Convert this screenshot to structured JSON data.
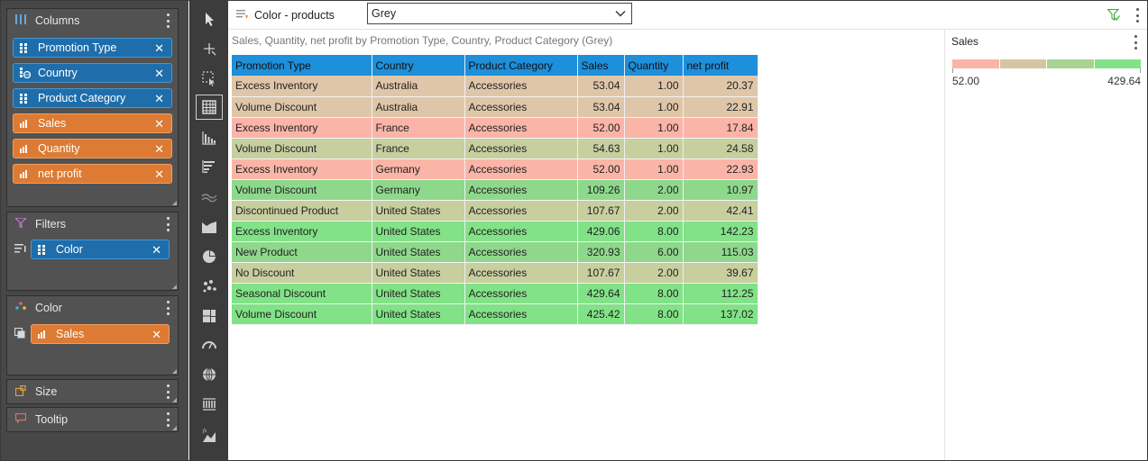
{
  "panels": {
    "columns": {
      "label": "Columns",
      "items": [
        {
          "label": "Promotion Type",
          "kind": "dimension"
        },
        {
          "label": "Country",
          "kind": "geo-dimension"
        },
        {
          "label": "Product Category",
          "kind": "dimension"
        },
        {
          "label": "Sales",
          "kind": "measure"
        },
        {
          "label": "Quantity",
          "kind": "measure"
        },
        {
          "label": "net profit",
          "kind": "measure"
        }
      ]
    },
    "filters": {
      "label": "Filters",
      "items": [
        {
          "label": "Color",
          "kind": "dimension"
        }
      ]
    },
    "color": {
      "label": "Color",
      "items": [
        {
          "label": "Sales",
          "kind": "measure"
        }
      ]
    },
    "size": {
      "label": "Size"
    },
    "tooltip": {
      "label": "Tooltip"
    }
  },
  "toolbar": {
    "tools": [
      "pointer-icon",
      "crosshair-icon",
      "marquee-select-icon",
      "table-icon",
      "column-chart-icon",
      "bar-chart-icon",
      "line-chart-icon",
      "area-chart-icon",
      "pie-chart-icon",
      "scatter-icon",
      "treemap-icon",
      "gauge-icon",
      "map-globe-icon",
      "pivot-grid-icon",
      "formula-chart-icon"
    ],
    "active": "table-icon"
  },
  "header": {
    "title": "Color - products",
    "select_value": "Grey"
  },
  "subtitle": "Sales, Quantity, net profit by Promotion Type, Country, Product Category (Grey)",
  "table": {
    "columns": [
      "Promotion Type",
      "Country",
      "Product Category",
      "Sales",
      "Quantity",
      "net profit"
    ],
    "rows": [
      {
        "cells": [
          "Excess Inventory",
          "Australia",
          "Accessories",
          "53.04",
          "1.00",
          "20.37"
        ],
        "color": "#dfc6a9"
      },
      {
        "cells": [
          "Volume Discount",
          "Australia",
          "Accessories",
          "53.04",
          "1.00",
          "22.91"
        ],
        "color": "#dfc6a9"
      },
      {
        "cells": [
          "Excess Inventory",
          "France",
          "Accessories",
          "52.00",
          "1.00",
          "17.84"
        ],
        "color": "#fab5a8"
      },
      {
        "cells": [
          "Volume Discount",
          "France",
          "Accessories",
          "54.63",
          "1.00",
          "24.58"
        ],
        "color": "#c7cf9f"
      },
      {
        "cells": [
          "Excess Inventory",
          "Germany",
          "Accessories",
          "52.00",
          "1.00",
          "22.93"
        ],
        "color": "#fab5a8"
      },
      {
        "cells": [
          "Volume Discount",
          "Germany",
          "Accessories",
          "109.26",
          "2.00",
          "10.97"
        ],
        "color": "#8ed88c"
      },
      {
        "cells": [
          "Discontinued Product",
          "United States",
          "Accessories",
          "107.67",
          "2.00",
          "42.41"
        ],
        "color": "#c7cf9f"
      },
      {
        "cells": [
          "Excess Inventory",
          "United States",
          "Accessories",
          "429.06",
          "8.00",
          "142.23"
        ],
        "color": "#82e287"
      },
      {
        "cells": [
          "New Product",
          "United States",
          "Accessories",
          "320.93",
          "6.00",
          "115.03"
        ],
        "color": "#8ed88c"
      },
      {
        "cells": [
          "No Discount",
          "United States",
          "Accessories",
          "107.67",
          "2.00",
          "39.67"
        ],
        "color": "#c7cf9f"
      },
      {
        "cells": [
          "Seasonal Discount",
          "United States",
          "Accessories",
          "429.64",
          "8.00",
          "112.25"
        ],
        "color": "#82e287"
      },
      {
        "cells": [
          "Volume Discount",
          "United States",
          "Accessories",
          "425.42",
          "8.00",
          "137.02"
        ],
        "color": "#82e287"
      }
    ]
  },
  "legend": {
    "title": "Sales",
    "min": "52.00",
    "max": "429.64",
    "colors": [
      "#fab5a8",
      "#d6c4a2",
      "#a9d393",
      "#82e287"
    ]
  },
  "colors": {
    "header_blue": "#1e8fda",
    "pill_blue": "#1f6eab",
    "pill_orange": "#dd7a33"
  }
}
